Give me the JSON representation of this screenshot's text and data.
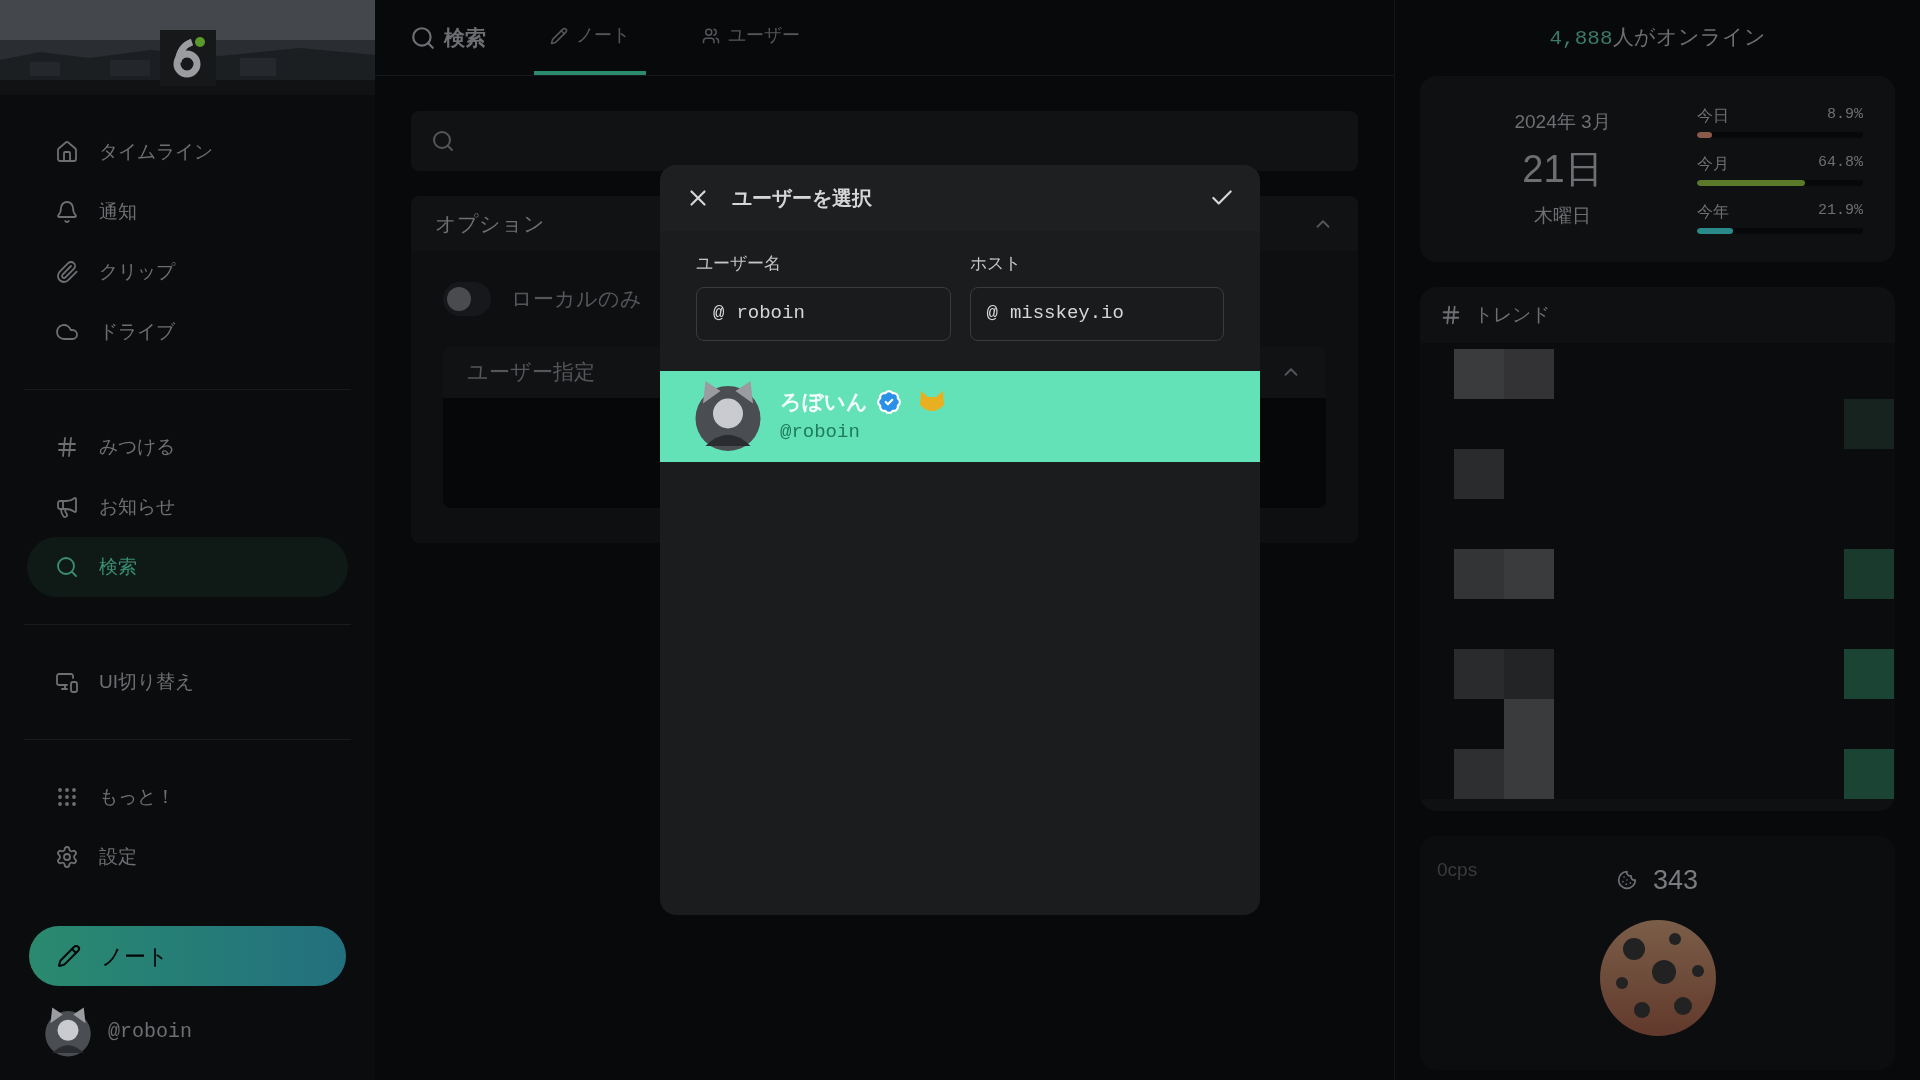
{
  "sidebar": {
    "groups": [
      {
        "items": [
          {
            "label": "タイムライン",
            "selected": false
          },
          {
            "label": "通知",
            "selected": false
          },
          {
            "label": "クリップ",
            "selected": false
          },
          {
            "label": "ドライブ",
            "selected": false
          }
        ]
      },
      {
        "items": [
          {
            "label": "みつける",
            "selected": false
          },
          {
            "label": "お知らせ",
            "selected": false
          },
          {
            "label": "検索",
            "selected": true
          }
        ]
      },
      {
        "items": [
          {
            "label": "UI切り替え",
            "selected": false
          }
        ]
      },
      {
        "items": [
          {
            "label": "もっと！",
            "selected": false
          },
          {
            "label": "設定",
            "selected": false
          }
        ]
      }
    ],
    "note_button": {
      "label": "ノート"
    },
    "account": {
      "handle": "@roboin"
    }
  },
  "header": {
    "title": "検索",
    "tabs": [
      {
        "label": "ノート",
        "selected": true
      },
      {
        "label": "ユーザー",
        "selected": false
      }
    ]
  },
  "options": {
    "title": "オプション",
    "expanded": true,
    "local_only": {
      "label": "ローカルのみ",
      "on": false
    },
    "user_filter": {
      "title": "ユーザー指定",
      "expanded": true
    }
  },
  "dialog": {
    "title": "ユーザーを選択",
    "fields": [
      {
        "label": "ユーザー名",
        "prefix": "@",
        "value": "roboin"
      },
      {
        "label": "ホスト",
        "prefix": "@",
        "value": "misskey.io"
      }
    ],
    "results": [
      {
        "name": "ろぼいん",
        "handle": "@roboin",
        "verified": true,
        "selected": true
      }
    ]
  },
  "online": {
    "count": "4,888",
    "suffix": "人がオンライン"
  },
  "calendar": {
    "year_month": "2024年 3月",
    "day": "21日",
    "weekday": "木曜日",
    "progress": [
      {
        "label": "今日",
        "reading": "8.9%",
        "level": 0.089,
        "color": "#8a5a4a"
      },
      {
        "label": "今月",
        "reading": "64.8%",
        "level": 0.648,
        "color": "#5a7a2a"
      },
      {
        "label": "今年",
        "reading": "21.9%",
        "level": 0.219,
        "color": "#2a8a8a"
      }
    ]
  },
  "trend": {
    "title": "トレンド"
  },
  "cookie": {
    "cps": "0cps",
    "count": "343"
  }
}
